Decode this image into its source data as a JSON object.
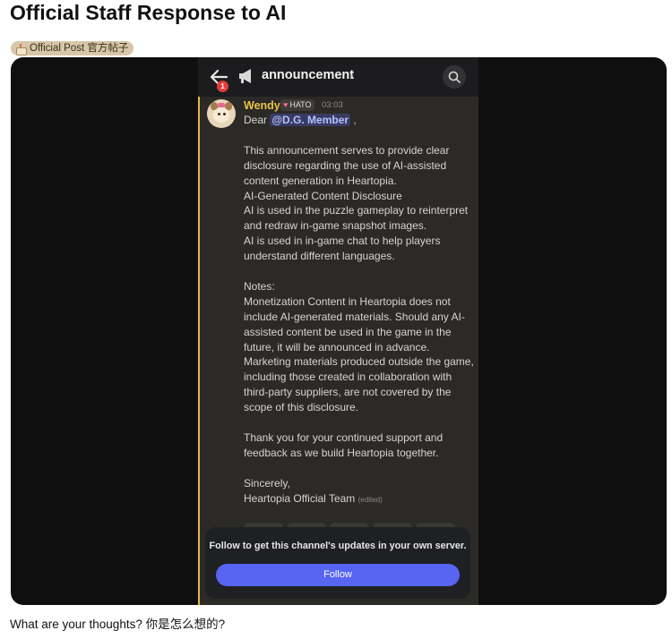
{
  "post": {
    "title": "Official Staff Response to AI",
    "tag_label": "Official Post 官方帖子",
    "caption": "What are your thoughts? 你是怎么想的?"
  },
  "screenshot": {
    "header": {
      "notification_count": "1",
      "channel_name": "announcement",
      "chevron": "›"
    },
    "message": {
      "author": "Wendy",
      "role_badge": "HATO",
      "time": "03:03",
      "greeting_prefix": "Dear ",
      "mention": "@D.G. Member",
      "greeting_suffix": " ,",
      "intro": "This announcement serves to provide clear disclosure regarding the use of AI-assisted content generation in Heartopia.",
      "section_title": "AI-Generated Content Disclosure",
      "point_1": "AI is used in the puzzle gameplay to reinterpret and redraw in-game snapshot images.",
      "point_2": "AI is used in in-game chat to help players understand different languages.",
      "notes_title": "Notes:",
      "note_1": "Monetization Content in Heartopia does not include AI-generated materials. Should any AI-assisted content be used in the game in the future, it will be announced in advance.",
      "note_2": "Marketing materials produced outside the game, including those created in collaboration with third-party suppliers, are not covered by the scope of this disclosure.",
      "thanks": "Thank you for your continued support and feedback as we build Heartopia together.",
      "signoff": "Sincerely,",
      "signature": "Heartopia Official Team",
      "edited_label": "(edited)"
    },
    "follow_card": {
      "text": "Follow to get this channel's updates in your own server.",
      "button_label": "Follow"
    },
    "colors": {
      "accent_bar": "#e8b44a",
      "follow_button": "#5865f2",
      "author_name": "#e8c24a"
    }
  }
}
